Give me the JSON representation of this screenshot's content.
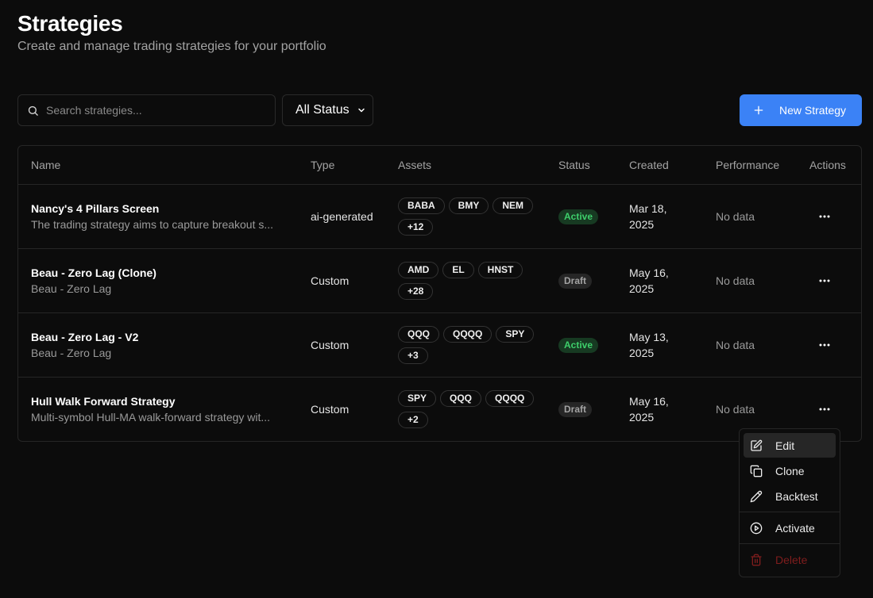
{
  "header": {
    "title": "Strategies",
    "subtitle": "Create and manage trading strategies for your portfolio"
  },
  "toolbar": {
    "search_placeholder": "Search strategies...",
    "status_filter": "All Status",
    "new_button": "New Strategy"
  },
  "table": {
    "columns": [
      "Name",
      "Type",
      "Assets",
      "Status",
      "Created",
      "Performance",
      "Actions"
    ],
    "rows": [
      {
        "name": "Nancy's 4 Pillars Screen",
        "description": "The trading strategy aims to capture breakout s...",
        "type": "ai-generated",
        "assets": [
          "BABA",
          "BMY",
          "NEM",
          "+12"
        ],
        "status": "Active",
        "created": "Mar 18, 2025",
        "performance": "No data"
      },
      {
        "name": "Beau - Zero Lag (Clone)",
        "description": "Beau - Zero Lag",
        "type": "Custom",
        "assets": [
          "AMD",
          "EL",
          "HNST",
          "+28"
        ],
        "status": "Draft",
        "created": "May 16, 2025",
        "performance": "No data"
      },
      {
        "name": "Beau - Zero Lag - V2",
        "description": "Beau - Zero Lag",
        "type": "Custom",
        "assets": [
          "QQQ",
          "QQQQ",
          "SPY",
          "+3"
        ],
        "status": "Active",
        "created": "May 13, 2025",
        "performance": "No data"
      },
      {
        "name": "Hull Walk Forward Strategy",
        "description": "Multi-symbol Hull-MA walk-forward strategy wit...",
        "type": "Custom",
        "assets": [
          "SPY",
          "QQQ",
          "QQQQ",
          "+2"
        ],
        "status": "Draft",
        "created": "May 16, 2025",
        "performance": "No data"
      }
    ]
  },
  "menu": {
    "edit": "Edit",
    "clone": "Clone",
    "backtest": "Backtest",
    "activate": "Activate",
    "delete": "Delete"
  },
  "colors": {
    "accent": "#3b82f6",
    "active_text": "#3ecf6b",
    "danger": "#7f1d1d"
  }
}
